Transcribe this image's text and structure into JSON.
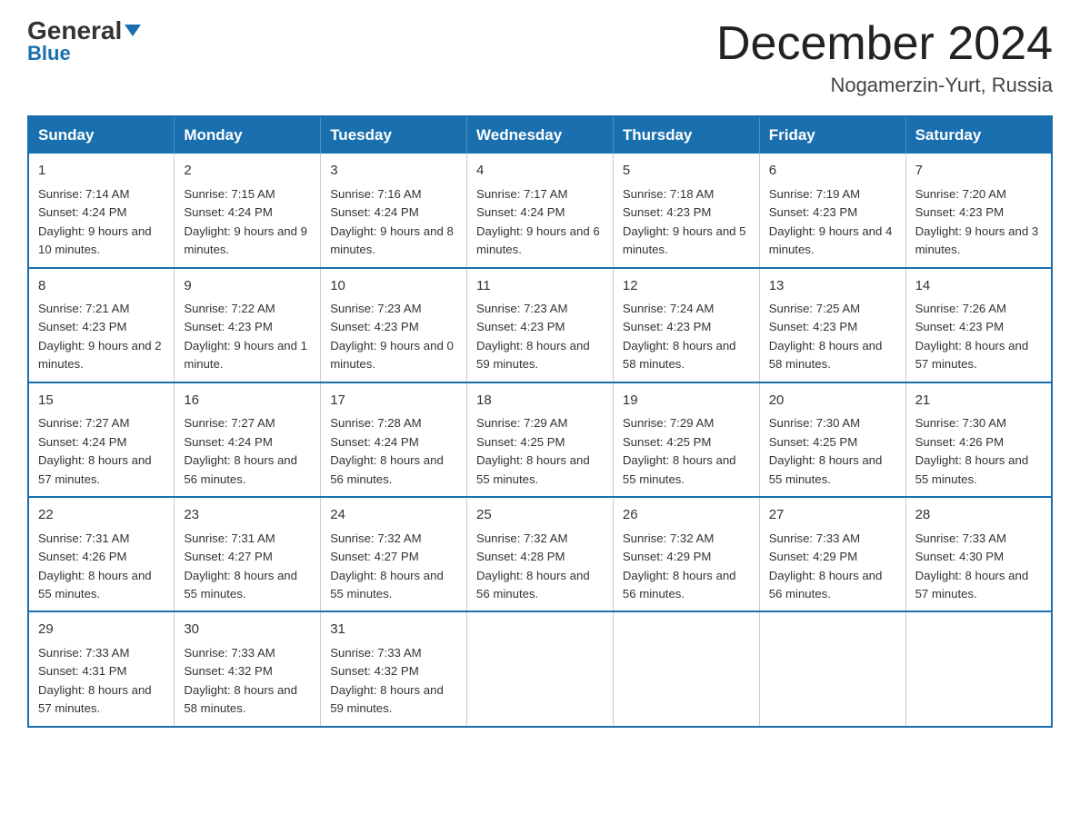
{
  "logo": {
    "general": "General",
    "blue": "Blue"
  },
  "header": {
    "month_year": "December 2024",
    "location": "Nogamerzin-Yurt, Russia"
  },
  "days_of_week": [
    "Sunday",
    "Monday",
    "Tuesday",
    "Wednesday",
    "Thursday",
    "Friday",
    "Saturday"
  ],
  "weeks": [
    [
      {
        "day": "1",
        "sunrise": "7:14 AM",
        "sunset": "4:24 PM",
        "daylight": "9 hours and 10 minutes."
      },
      {
        "day": "2",
        "sunrise": "7:15 AM",
        "sunset": "4:24 PM",
        "daylight": "9 hours and 9 minutes."
      },
      {
        "day": "3",
        "sunrise": "7:16 AM",
        "sunset": "4:24 PM",
        "daylight": "9 hours and 8 minutes."
      },
      {
        "day": "4",
        "sunrise": "7:17 AM",
        "sunset": "4:24 PM",
        "daylight": "9 hours and 6 minutes."
      },
      {
        "day": "5",
        "sunrise": "7:18 AM",
        "sunset": "4:23 PM",
        "daylight": "9 hours and 5 minutes."
      },
      {
        "day": "6",
        "sunrise": "7:19 AM",
        "sunset": "4:23 PM",
        "daylight": "9 hours and 4 minutes."
      },
      {
        "day": "7",
        "sunrise": "7:20 AM",
        "sunset": "4:23 PM",
        "daylight": "9 hours and 3 minutes."
      }
    ],
    [
      {
        "day": "8",
        "sunrise": "7:21 AM",
        "sunset": "4:23 PM",
        "daylight": "9 hours and 2 minutes."
      },
      {
        "day": "9",
        "sunrise": "7:22 AM",
        "sunset": "4:23 PM",
        "daylight": "9 hours and 1 minute."
      },
      {
        "day": "10",
        "sunrise": "7:23 AM",
        "sunset": "4:23 PM",
        "daylight": "9 hours and 0 minutes."
      },
      {
        "day": "11",
        "sunrise": "7:23 AM",
        "sunset": "4:23 PM",
        "daylight": "8 hours and 59 minutes."
      },
      {
        "day": "12",
        "sunrise": "7:24 AM",
        "sunset": "4:23 PM",
        "daylight": "8 hours and 58 minutes."
      },
      {
        "day": "13",
        "sunrise": "7:25 AM",
        "sunset": "4:23 PM",
        "daylight": "8 hours and 58 minutes."
      },
      {
        "day": "14",
        "sunrise": "7:26 AM",
        "sunset": "4:23 PM",
        "daylight": "8 hours and 57 minutes."
      }
    ],
    [
      {
        "day": "15",
        "sunrise": "7:27 AM",
        "sunset": "4:24 PM",
        "daylight": "8 hours and 57 minutes."
      },
      {
        "day": "16",
        "sunrise": "7:27 AM",
        "sunset": "4:24 PM",
        "daylight": "8 hours and 56 minutes."
      },
      {
        "day": "17",
        "sunrise": "7:28 AM",
        "sunset": "4:24 PM",
        "daylight": "8 hours and 56 minutes."
      },
      {
        "day": "18",
        "sunrise": "7:29 AM",
        "sunset": "4:25 PM",
        "daylight": "8 hours and 55 minutes."
      },
      {
        "day": "19",
        "sunrise": "7:29 AM",
        "sunset": "4:25 PM",
        "daylight": "8 hours and 55 minutes."
      },
      {
        "day": "20",
        "sunrise": "7:30 AM",
        "sunset": "4:25 PM",
        "daylight": "8 hours and 55 minutes."
      },
      {
        "day": "21",
        "sunrise": "7:30 AM",
        "sunset": "4:26 PM",
        "daylight": "8 hours and 55 minutes."
      }
    ],
    [
      {
        "day": "22",
        "sunrise": "7:31 AM",
        "sunset": "4:26 PM",
        "daylight": "8 hours and 55 minutes."
      },
      {
        "day": "23",
        "sunrise": "7:31 AM",
        "sunset": "4:27 PM",
        "daylight": "8 hours and 55 minutes."
      },
      {
        "day": "24",
        "sunrise": "7:32 AM",
        "sunset": "4:27 PM",
        "daylight": "8 hours and 55 minutes."
      },
      {
        "day": "25",
        "sunrise": "7:32 AM",
        "sunset": "4:28 PM",
        "daylight": "8 hours and 56 minutes."
      },
      {
        "day": "26",
        "sunrise": "7:32 AM",
        "sunset": "4:29 PM",
        "daylight": "8 hours and 56 minutes."
      },
      {
        "day": "27",
        "sunrise": "7:33 AM",
        "sunset": "4:29 PM",
        "daylight": "8 hours and 56 minutes."
      },
      {
        "day": "28",
        "sunrise": "7:33 AM",
        "sunset": "4:30 PM",
        "daylight": "8 hours and 57 minutes."
      }
    ],
    [
      {
        "day": "29",
        "sunrise": "7:33 AM",
        "sunset": "4:31 PM",
        "daylight": "8 hours and 57 minutes."
      },
      {
        "day": "30",
        "sunrise": "7:33 AM",
        "sunset": "4:32 PM",
        "daylight": "8 hours and 58 minutes."
      },
      {
        "day": "31",
        "sunrise": "7:33 AM",
        "sunset": "4:32 PM",
        "daylight": "8 hours and 59 minutes."
      },
      null,
      null,
      null,
      null
    ]
  ],
  "labels": {
    "sunrise": "Sunrise:",
    "sunset": "Sunset:",
    "daylight": "Daylight:"
  }
}
